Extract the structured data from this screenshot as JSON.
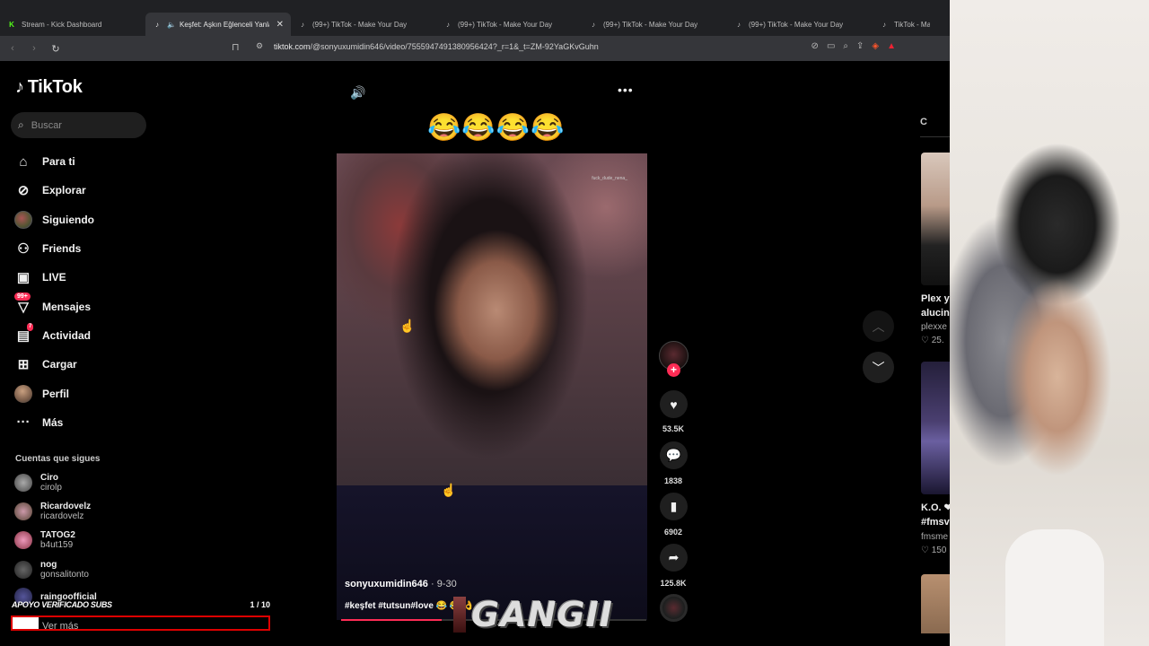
{
  "browser": {
    "tabs": [
      {
        "label": "Stream - Kick Dashboard",
        "icon": "kick-icon",
        "active": false
      },
      {
        "label": "Keşfet: Aşkın Eğlenceli Yanları",
        "icon": "tiktok-icon",
        "active": true
      },
      {
        "label": "(99+) TikTok - Make Your Day",
        "icon": "tiktok-icon",
        "active": false
      },
      {
        "label": "(99+) TikTok - Make Your Day",
        "icon": "tiktok-icon",
        "active": false
      },
      {
        "label": "(99+) TikTok - Make Your Day",
        "icon": "tiktok-icon",
        "active": false
      },
      {
        "label": "(99+) TikTok - Make Your Day",
        "icon": "tiktok-icon",
        "active": false
      },
      {
        "label": "TikTok - Make Yo",
        "icon": "tiktok-icon",
        "active": false
      }
    ],
    "url_host": "tiktok.com",
    "url_path": "/@sonyuxumidin646/video/7555947491380956424?_r=1&_t=ZM-92YaGKvGuhn"
  },
  "sidebar": {
    "logo": "TikTok",
    "search_placeholder": "Buscar",
    "nav": [
      {
        "label": "Para ti",
        "icon": "home-icon"
      },
      {
        "label": "Explorar",
        "icon": "compass-icon"
      },
      {
        "label": "Siguiendo",
        "icon": "avatar-icon"
      },
      {
        "label": "Friends",
        "icon": "friends-icon"
      },
      {
        "label": "LIVE",
        "icon": "live-icon"
      },
      {
        "label": "Mensajes",
        "icon": "messages-icon",
        "badge": "99+"
      },
      {
        "label": "Actividad",
        "icon": "activity-icon",
        "badge": "7"
      },
      {
        "label": "Cargar",
        "icon": "upload-icon"
      },
      {
        "label": "Perfil",
        "icon": "profile-avatar-icon"
      },
      {
        "label": "Más",
        "icon": "more-icon"
      }
    ],
    "following_title": "Cuentas que sigues",
    "accounts": [
      {
        "name": "Ciro",
        "handle": "cirolp"
      },
      {
        "name": "Ricardovelz",
        "handle": "ricardovelz"
      },
      {
        "name": "TATOG2",
        "handle": "b4ut159"
      },
      {
        "name": "nog",
        "handle": "gonsalitonto"
      },
      {
        "name": "raingoofficial",
        "handle": ""
      }
    ],
    "ver_mas": "Ver más"
  },
  "overlay": {
    "label": "APOYO VERIFICADO SUBS",
    "count": "1 / 10",
    "progress": 0.1
  },
  "video": {
    "caption_emoji": "😂😂😂😂",
    "watermark": "fuck_dude_nena_",
    "author": "sonyuxumidin646",
    "date": " · 9-30",
    "tags": "#keşfet #tutsun#love 😂 😂 👌",
    "progress": 0.33
  },
  "actions": {
    "likes": "53.5K",
    "comments": "1838",
    "saves": "6902",
    "shares": "125.8K"
  },
  "stream_overlay": {
    "logo_text": "GANGII"
  },
  "right_column": {
    "header": "C",
    "item1_title_line1": "Plex y",
    "item1_title_line2": "alucin",
    "item1_author": "plexxe",
    "item1_likes": "25.",
    "item2_title_line1": "K.O. ❤",
    "item2_title_line2": "#fmsv",
    "item2_author": "fmsme",
    "item2_likes": "150"
  }
}
